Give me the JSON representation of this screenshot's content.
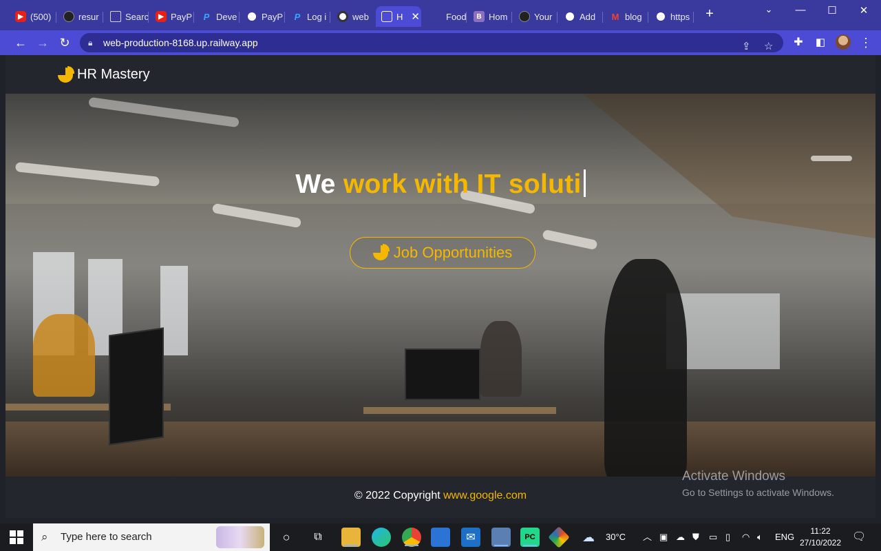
{
  "browser": {
    "tabs": [
      {
        "label": "(500)",
        "icon": "youtube-icon"
      },
      {
        "label": "resur",
        "icon": "github-icon"
      },
      {
        "label": "Searc",
        "icon": "flag-icon"
      },
      {
        "label": "PayP",
        "icon": "youtube-icon"
      },
      {
        "label": "Deve",
        "icon": "paypal-icon"
      },
      {
        "label": "PayP",
        "icon": "globe-icon"
      },
      {
        "label": "Log i",
        "icon": "paypal-icon"
      },
      {
        "label": "web",
        "icon": "ring-icon"
      },
      {
        "label": "H",
        "icon": "briefcase-icon",
        "active": true
      },
      {
        "label": "Food",
        "icon": "blank-icon"
      },
      {
        "label": "Hom",
        "icon": "bootstrap-icon"
      },
      {
        "label": "Your",
        "icon": "github-icon"
      },
      {
        "label": "Add",
        "icon": "globe-icon"
      },
      {
        "label": "blog",
        "icon": "gmail-icon"
      },
      {
        "label": "https",
        "icon": "globe-icon"
      }
    ],
    "url": "web-production-8168.up.railway.app"
  },
  "page": {
    "brand": "HR Mastery",
    "headline_white": "We",
    "headline_accent": "work with IT soluti",
    "cta_label": "Job Opportunities",
    "footer_text": "© 2022 Copyright",
    "footer_link": "www.google.com",
    "accent_color": "#f5b800"
  },
  "watermark": {
    "line1": "Activate Windows",
    "line2": "Go to Settings to activate Windows."
  },
  "taskbar": {
    "search_placeholder": "Type here to search",
    "weather": "30°C",
    "language": "ENG",
    "time": "11:22",
    "date": "27/10/2022"
  }
}
